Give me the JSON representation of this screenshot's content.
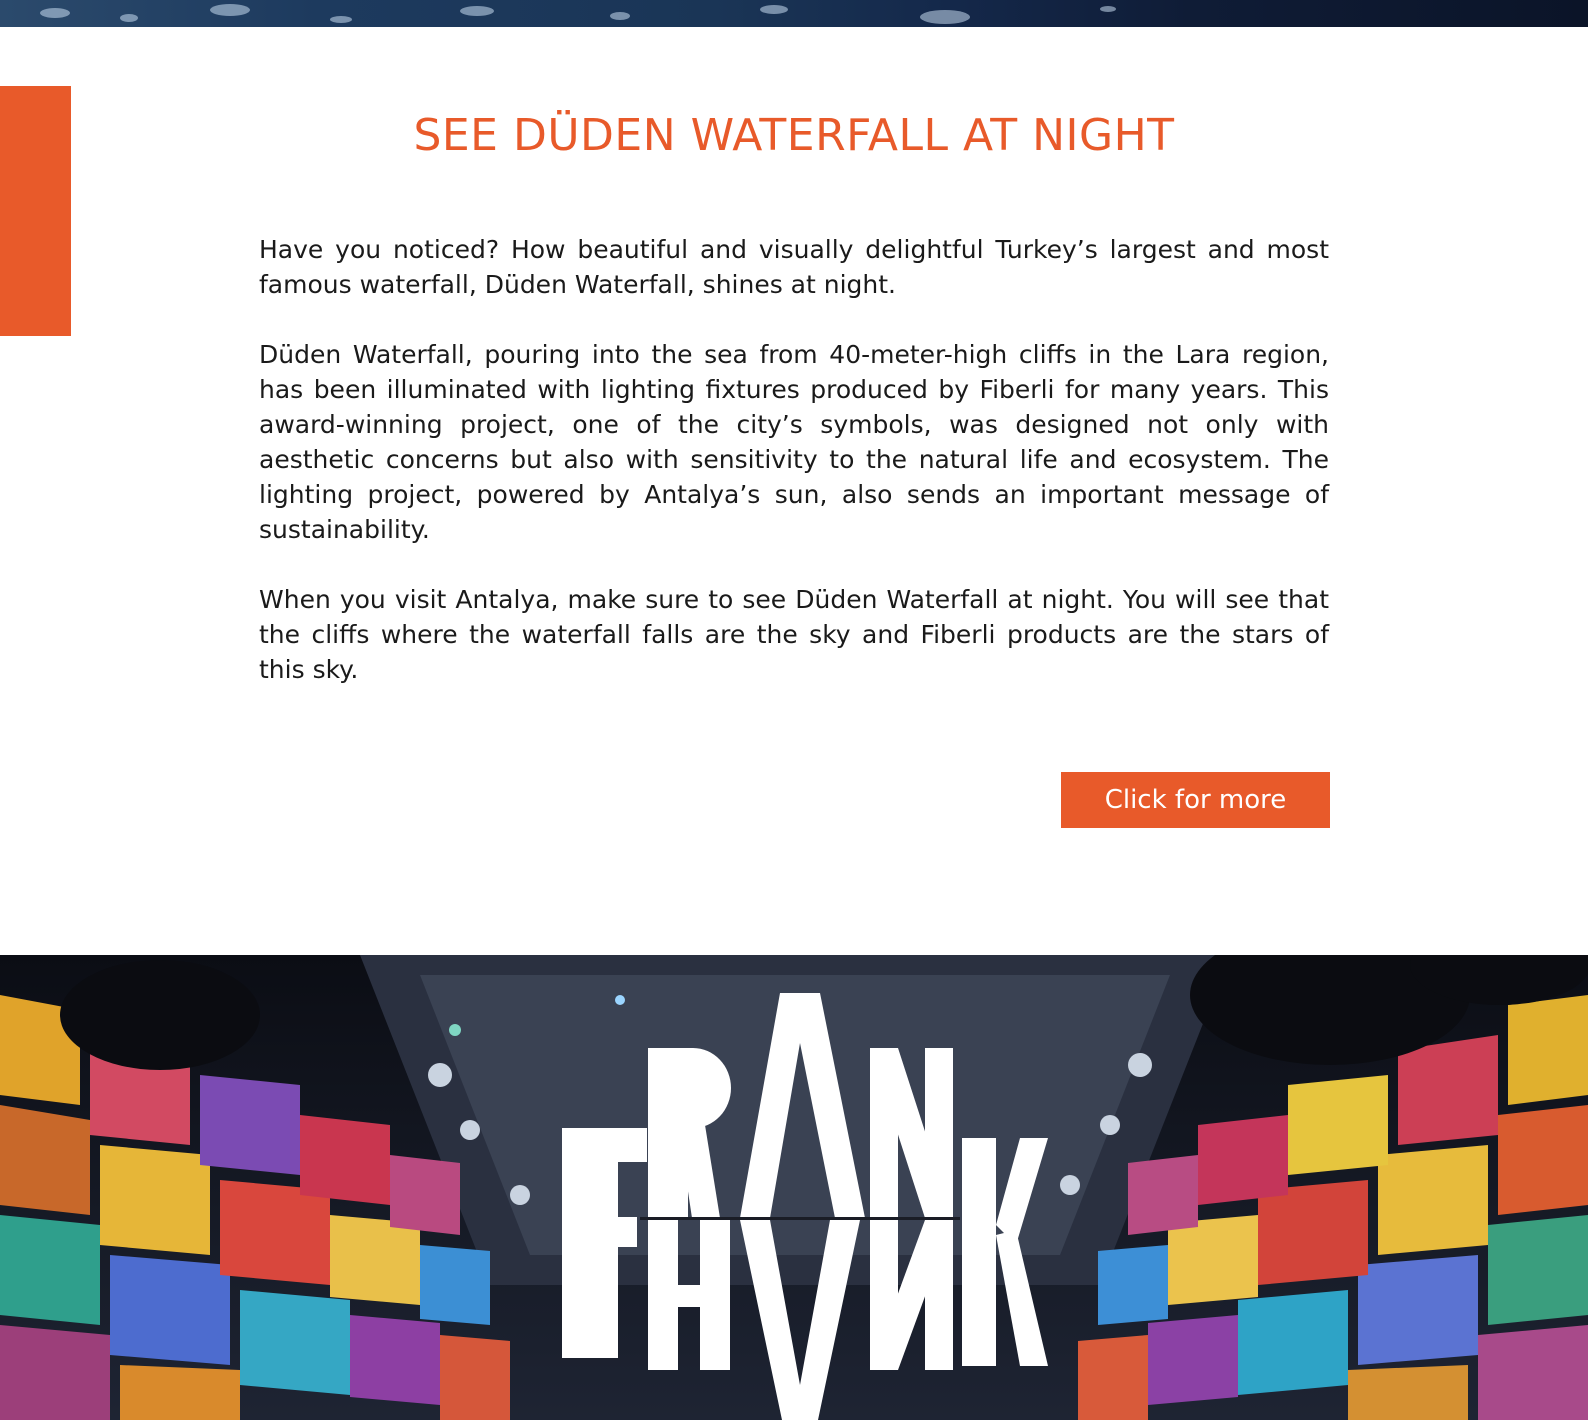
{
  "section": {
    "title": "SEE DÜDEN WATERFALL AT NIGHT",
    "paragraphs": [
      "Have you noticed? How beautiful and visually delightful Turkey’s largest and most famous waterfall, Düden Waterfall, shines at night.",
      "Düden Waterfall, pouring into the sea from 40-meter-high cliffs in the Lara region, has been illuminated with lighting fixtures produced by Fiberli for many years. This award-winning project, one of the city’s symbols, was designed not only with aesthetic concerns but also with sensitivity to the natural life and ecosystem. The lighting project, powered by Antalya’s sun, also sends an important message of sustainability.",
      "When you visit Antalya, make sure to see Düden Waterfall at night. You will see that the cliffs where the waterfall falls are the sky and Fiberli products are the stars of this sky."
    ],
    "button_label": "Click for more"
  },
  "banner": {
    "logo_text": "FRANK"
  },
  "colors": {
    "accent": "#e85a2a",
    "text": "#1a1a1a",
    "background": "#ffffff"
  }
}
